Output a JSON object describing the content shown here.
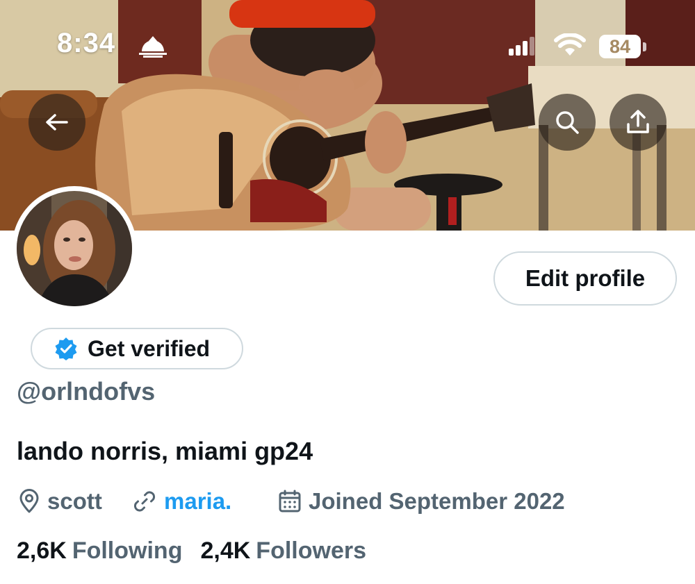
{
  "status_bar": {
    "time": "8:34",
    "battery": "84"
  },
  "banner": {
    "image": "cover-photo"
  },
  "nav": {
    "back_icon": "arrow-left-icon",
    "search_icon": "search-icon",
    "share_icon": "share-icon"
  },
  "profile": {
    "edit_label": "Edit profile",
    "get_verified_label": "Get verified",
    "handle": "@orlndofvs",
    "bio": "lando norris, miami gp24",
    "location": "scott",
    "website": "maria.",
    "joined": "Joined September 2022",
    "following_count": "2,6K",
    "following_label": "Following",
    "followers_count": "2,4K",
    "followers_label": "Followers"
  },
  "colors": {
    "accent": "#1d9bf0",
    "secondary_text": "#536471",
    "primary_text": "#0f1419",
    "border": "#cfd9de"
  }
}
